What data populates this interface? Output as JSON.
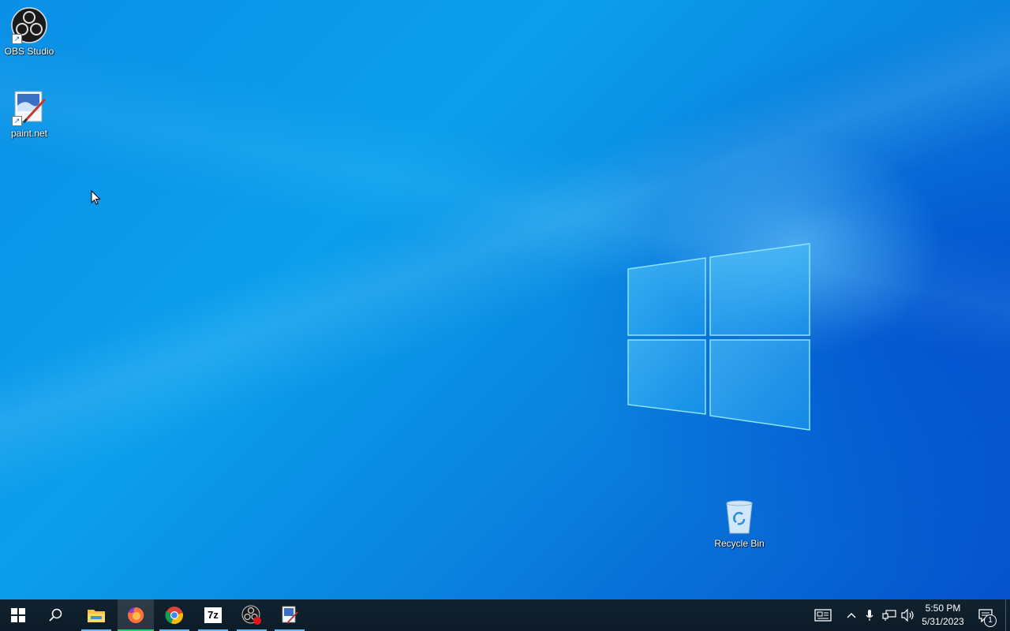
{
  "desktop": {
    "icons": [
      {
        "label": "OBS Studio",
        "icon": "obs-icon"
      },
      {
        "label": "paint.net",
        "icon": "paint-net-icon"
      },
      {
        "label": "Recycle Bin",
        "icon": "recycle-bin-icon"
      }
    ]
  },
  "taskbar": {
    "start": {
      "icon": "windows-start-icon"
    },
    "search": {
      "icon": "search-icon"
    },
    "pinned_apps": [
      {
        "name": "File Explorer",
        "icon": "file-explorer-icon"
      },
      {
        "name": "Firefox",
        "icon": "firefox-icon",
        "active": true
      },
      {
        "name": "Google Chrome",
        "icon": "chrome-icon"
      },
      {
        "name": "7-Zip",
        "icon": "7zip-icon",
        "text": "7z"
      },
      {
        "name": "OBS Studio",
        "icon": "obs-icon"
      },
      {
        "name": "paint.net",
        "icon": "paint-net-icon"
      }
    ],
    "tray": {
      "icons": [
        "news-icon",
        "chevron-up-icon",
        "microphone-icon",
        "network-icon",
        "volume-icon"
      ],
      "time": "5:50 PM",
      "date": "5/31/2023",
      "notification_count": "1"
    }
  },
  "colors": {
    "taskbar_bg": "#0d1f2e",
    "wallpaper_blue": "#0a8fe6",
    "accent_underline": "#6cb8f0",
    "active_underline": "#2ecc71"
  }
}
